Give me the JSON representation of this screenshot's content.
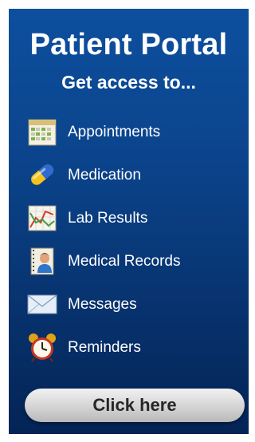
{
  "header": {
    "title": "Patient Portal",
    "subtitle": "Get access to..."
  },
  "features": [
    {
      "label": "Appointments",
      "icon": "calendar-icon"
    },
    {
      "label": "Medication",
      "icon": "pill-icon"
    },
    {
      "label": "Lab Results",
      "icon": "chart-icon"
    },
    {
      "label": "Medical Records",
      "icon": "records-icon"
    },
    {
      "label": "Messages",
      "icon": "envelope-icon"
    },
    {
      "label": "Reminders",
      "icon": "alarm-clock-icon"
    }
  ],
  "cta": {
    "label": "Click here"
  },
  "colors": {
    "background_top": "#0d4f9e",
    "background_bottom": "#042456",
    "text": "#ffffff",
    "button": "#d4d4d4"
  }
}
